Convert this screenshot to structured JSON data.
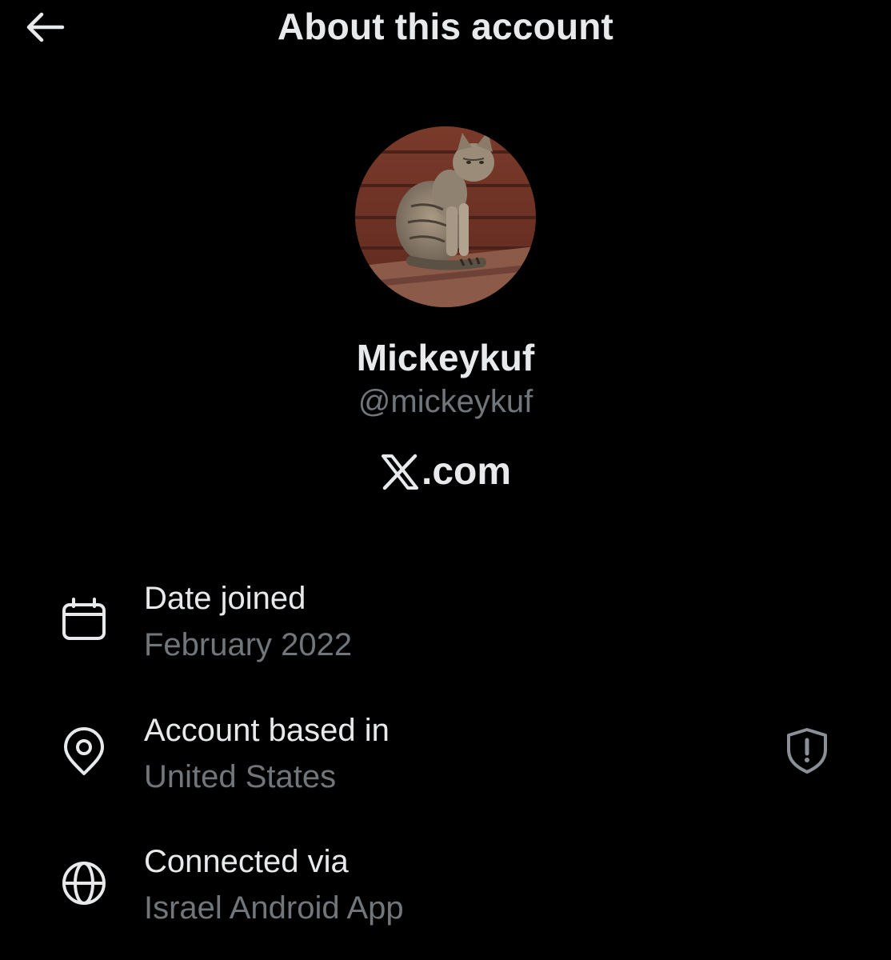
{
  "header": {
    "title": "About this account",
    "back_icon": "arrow-left-icon"
  },
  "profile": {
    "display_name": "Mickeykuf",
    "handle": "@mickeykuf",
    "avatar_description_icon": "cat-avatar",
    "platform": ".com",
    "platform_logo_icon": "x-logo-icon"
  },
  "details": [
    {
      "label": "Date joined",
      "value": "February 2022",
      "icon": "calendar-icon"
    },
    {
      "label": "Account based in",
      "value": "United States",
      "icon": "location-pin-icon",
      "trailing_icon": "shield-alert-icon"
    },
    {
      "label": "Connected via",
      "value": "Israel Android App",
      "icon": "globe-icon"
    }
  ],
  "colors": {
    "background": "#000000",
    "primary_text": "#e7e9ea",
    "secondary_text": "#71767b"
  }
}
